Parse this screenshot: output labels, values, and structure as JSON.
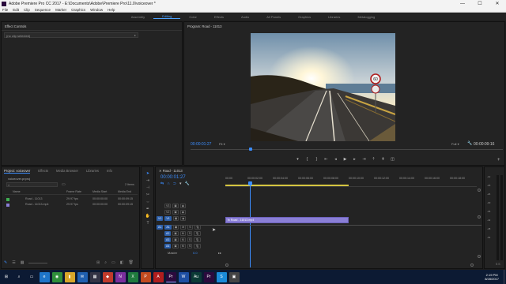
{
  "window": {
    "title": "Adobe Premiere Pro CC 2017 - E:\\Documents\\Adobe\\Premiere Pro\\11.0\\voiceover *",
    "minimize": "—",
    "maximize": "☐",
    "close": "✕"
  },
  "menu": [
    "File",
    "Edit",
    "Clip",
    "Sequence",
    "Marker",
    "Graphics",
    "Window",
    "Help"
  ],
  "workspaces": {
    "items": [
      "Assembly",
      "Editing",
      "Color",
      "Effects",
      "Audio",
      "All Panels",
      "Graphics",
      "Libraries",
      "Metalogging"
    ],
    "active_index": 1
  },
  "effect_controls": {
    "tab": "Effect Controls",
    "clip": "(no clip selected)"
  },
  "program": {
    "tab": "Program: Road - 11013",
    "timecode": "00:00:01:27",
    "fit": "Fit",
    "quality": "Full",
    "duration": "00:00:09:16",
    "signs": {
      "top": "60",
      "bottom": ""
    }
  },
  "project": {
    "tabs": [
      "Project: voiceover",
      "Effects",
      "Media Browser",
      "Libraries",
      "Info"
    ],
    "file": "voiceover.prproj",
    "count": "2 Items",
    "columns": [
      "Name",
      "Frame Rate",
      "Media Start",
      "Media End"
    ],
    "rows": [
      {
        "name": "Road - 11013",
        "rate": "29.97 fps",
        "start": "00:00:00:00",
        "end": "00:00:09:15",
        "color": "#3fae52"
      },
      {
        "name": "Road - 11013.mp4",
        "rate": "29.97 fps",
        "start": "00:00:00:00",
        "end": "00:00:09:15",
        "color": "#8a7fd6"
      }
    ]
  },
  "timeline": {
    "tab": "Road - 11013",
    "timecode": "00:00:01:27",
    "ruler": [
      "00:00",
      "00:00:02:00",
      "00:00:04:00",
      "00:00:06:00",
      "00:00:08:00",
      "00:00:10:00",
      "00:00:12:00",
      "00:00:14:00",
      "00:00:16:00",
      "00:00:18:00",
      "00:00:20:00"
    ],
    "clip_label": "Road - 11013.mp4",
    "volume": "0.0"
  },
  "taskbar": {
    "time": "2:19 PM",
    "date": "8/28/2017",
    "apps": [
      "⊞",
      "⌕",
      "▭",
      "e",
      "◉",
      "▮",
      "✉",
      "▦",
      "◆",
      "N",
      "X",
      "P",
      "A",
      "Pr",
      "W",
      "Au",
      "Pr",
      "S",
      "▣"
    ]
  },
  "colors": {
    "accent": "#3b8dff",
    "clip": "#8a7fd6",
    "timeline_bar": "#d5c540"
  }
}
